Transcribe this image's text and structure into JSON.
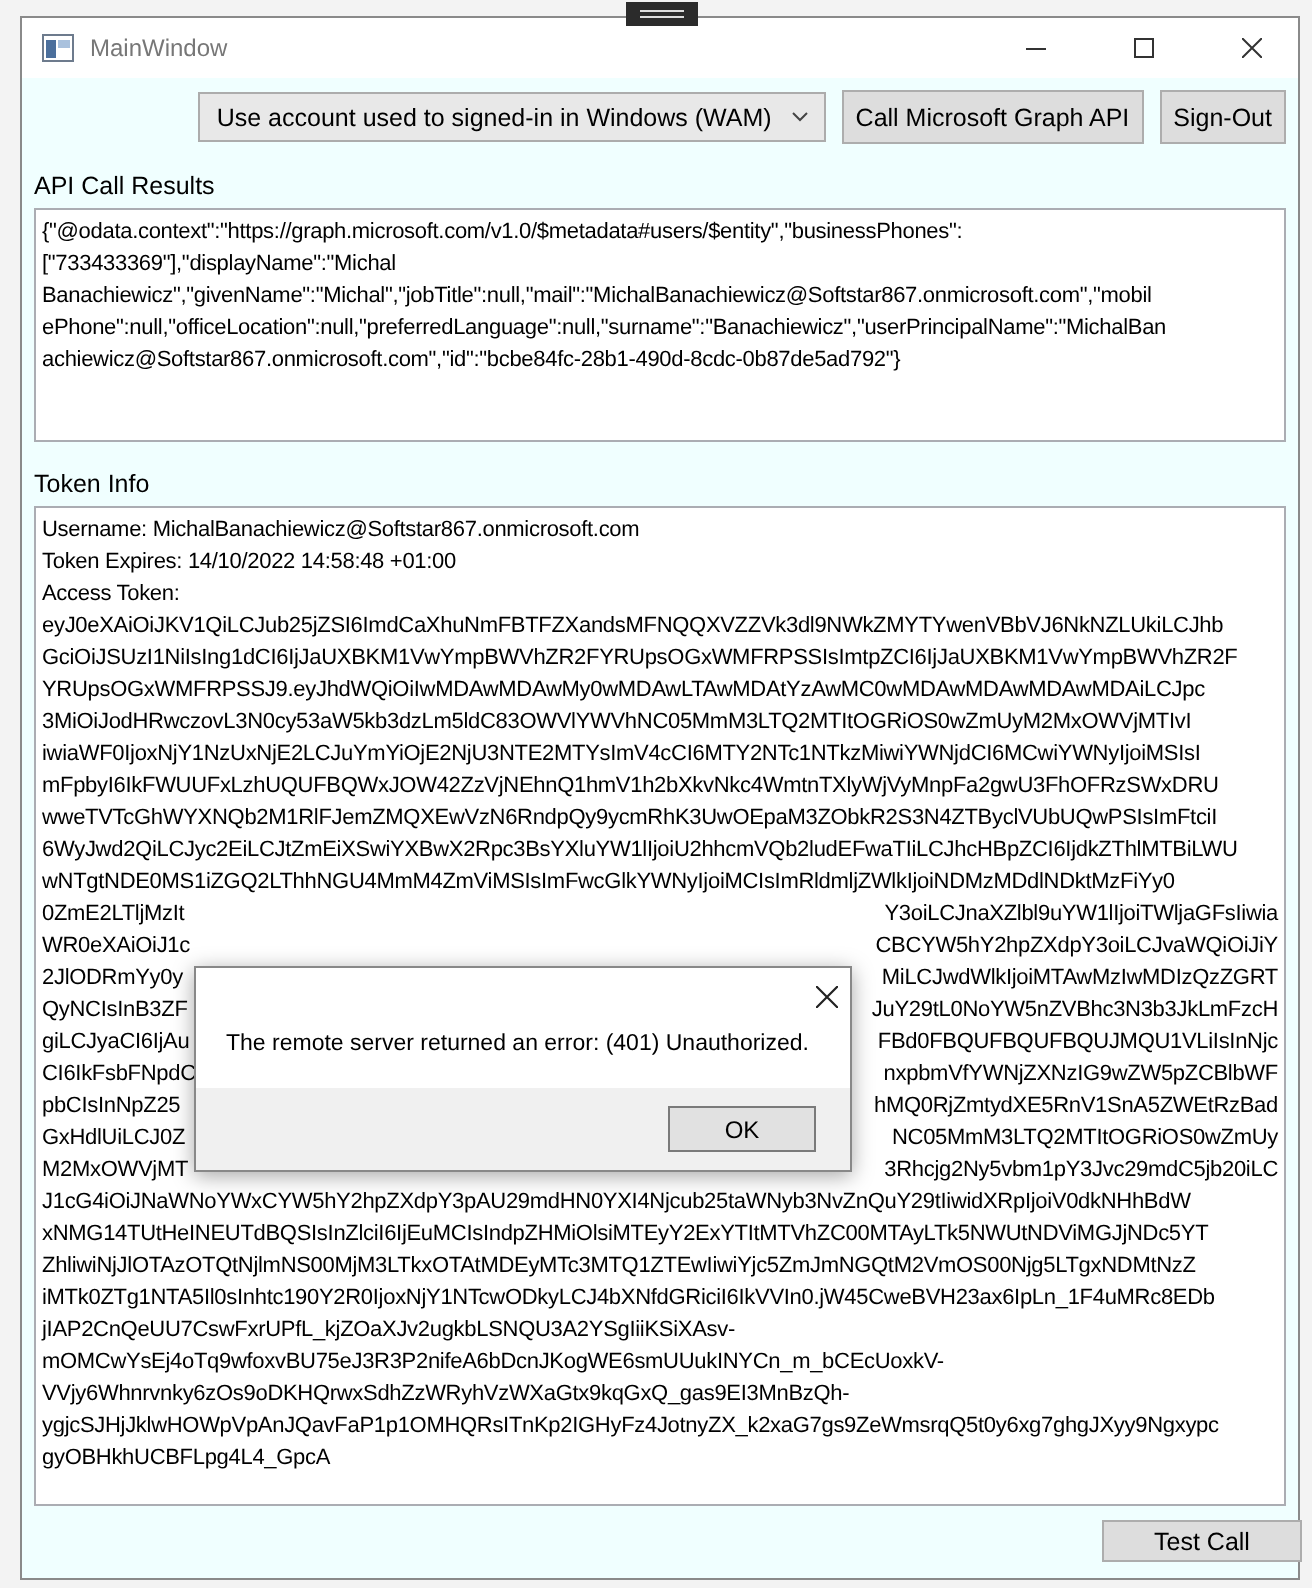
{
  "window": {
    "title": "MainWindow"
  },
  "toolbar": {
    "account_select": "Use account used to signed-in in Windows (WAM)",
    "buttons": [
      "Call Microsoft Graph API",
      "Sign-Out"
    ]
  },
  "api_results": {
    "label": "API Call Results",
    "lines": [
      "{\"@odata.context\":\"https://graph.microsoft.com/v1.0/$metadata#users/$entity\",\"businessPhones\":",
      "[\"733433369\"],\"displayName\":\"Michal",
      "Banachiewicz\",\"givenName\":\"Michal\",\"jobTitle\":null,\"mail\":\"MichalBanachiewicz@Softstar867.onmicrosoft.com\",\"mobil",
      "ePhone\":null,\"officeLocation\":null,\"preferredLanguage\":null,\"surname\":\"Banachiewicz\",\"userPrincipalName\":\"MichalBan",
      "achiewicz@Softstar867.onmicrosoft.com\",\"id\":\"bcbe84fc-28b1-490d-8cdc-0b87de5ad792\"}"
    ]
  },
  "token_info": {
    "label": "Token Info",
    "lines": [
      {
        "kind": "whole",
        "text": "Username: MichalBanachiewicz@Softstar867.onmicrosoft.com"
      },
      {
        "kind": "whole",
        "text": "Token Expires: 14/10/2022 14:58:48 +01:00"
      },
      {
        "kind": "whole",
        "text": "Access Token:"
      },
      {
        "kind": "whole",
        "text": "eyJ0eXAiOiJKV1QiLCJub25jZSI6ImdCaXhuNmFBTFZXandsMFNQQXVZZVk3dl9NWkZMYTYwenVBbVJ6NkNZLUkiLCJhb"
      },
      {
        "kind": "whole",
        "text": "GciOiJSUzI1NiIsIng1dCI6IjJaUXBKM1VwYmpBWVhZR2FYRUpsOGxWMFRPSSIsImtpZCI6IjJaUXBKM1VwYmpBWVhZR2F"
      },
      {
        "kind": "whole",
        "text": "YRUpsOGxWMFRPSSJ9.eyJhdWQiOiIwMDAwMDAwMy0wMDAwLTAwMDAtYzAwMC0wMDAwMDAwMDAwMDAiLCJpc"
      },
      {
        "kind": "whole",
        "text": "3MiOiJodHRwczovL3N0cy53aW5kb3dzLm5ldC83OWVlYWVhNC05MmM3LTQ2MTItOGRiOS0wZmUyM2MxOWVjMTIvI"
      },
      {
        "kind": "whole",
        "text": "iwiaWF0IjoxNjY1NzUxNjE2LCJuYmYiOjE2NjU3NTE2MTYsImV4cCI6MTY2NTc1NTkzMiwiYWNjdCI6MCwiYWNyIjoiMSIsI"
      },
      {
        "kind": "whole",
        "text": "mFpbyI6IkFWUUFxLzhUQUFBQWxJOW42ZzVjNEhnQ1hmV1h2bXkvNkc4WmtnTXlyWjVyMnpFa2gwU3FhOFRzSWxDRU"
      },
      {
        "kind": "whole",
        "text": "wweTVTcGhWYXNQb2M1RlFJemZMQXEwVzN6RndpQy9ycmRhK3UwOEpaM3ZObkR2S3N4ZTByclVUbUQwPSIsImFtciI"
      },
      {
        "kind": "whole",
        "text": "6WyJwd2QiLCJyc2EiLCJtZmEiXSwiYXBwX2Rpc3BsYXluYW1lIjoiU2hhcmVQb2ludEFwaTIiLCJhcHBpZCI6IjdkZThlMTBiLWU"
      },
      {
        "kind": "whole",
        "text": "wNTgtNDE0MS1iZGQ2LThhNGU4MmM4ZmViMSIsImFwcGlkYWNyIjoiMCIsImRldmljZWlkIjoiNDMzMDdlNDktMzFiYy0"
      },
      {
        "kind": "split",
        "left": "0ZmE2LTljMzIt",
        "right": "Y3oiLCJnaXZlbl9uYW1lIjoiTWljaGFsIiwia"
      },
      {
        "kind": "split",
        "left": "WR0eXAiOiJ1c",
        "right": "CBCYW5hY2hpZXdpY3oiLCJvaWQiOiJiY"
      },
      {
        "kind": "split",
        "left": "2JlODRmYy0y",
        "right": "MiLCJwdWlkIjoiMTAwMzIwMDIzQzZGRT"
      },
      {
        "kind": "split",
        "left": "QyNCIsInB3ZF",
        "right": "JuY29tL0NoYW5nZVBhc3N3b3JkLmFzcH"
      },
      {
        "kind": "split",
        "left": "giLCJyaCI6IjAu",
        "right": "FBd0FBQUFBQUFBQUJMQU1VLiIsInNjc"
      },
      {
        "kind": "split",
        "left": "CI6IkFsbFNpdC",
        "right": "nxpbmVfYWNjZXNzIG9wZW5pZCBlbWF"
      },
      {
        "kind": "split",
        "left": "pbCIsInNpZ25",
        "right": "hMQ0RjZmtydXE5RnV1SnA5ZWEtRzBad"
      },
      {
        "kind": "split",
        "left": "GxHdlUiLCJ0Z",
        "right": "NC05MmM3LTQ2MTItOGRiOS0wZmUy"
      },
      {
        "kind": "split",
        "left": "M2MxOWVjMT",
        "right": "3Rhcjg2Ny5vbm1pY3Jvc29mdC5jb20iLC"
      },
      {
        "kind": "whole",
        "text": "J1cG4iOiJNaWNoYWxCYW5hY2hpZXdpY3pAU29mdHN0YXI4Njcub25taWNyb3NvZnQuY29tIiwidXRpIjoiV0dkNHhBdW"
      },
      {
        "kind": "whole",
        "text": "xNMG14TUtHeINEUTdBQSIsInZlciI6IjEuMCIsIndpZHMiOlsiMTEyY2ExYTItMTVhZC00MTAyLTk5NWUtNDViMGJjNDc5YT"
      },
      {
        "kind": "whole",
        "text": "ZhliwiNjJlOTAzOTQtNjlmNS00MjM3LTkxOTAtMDEyMTc3MTQ1ZTEwIiwiYjc5ZmJmNGQtM2VmOS00Njg5LTgxNDMtNzZ"
      },
      {
        "kind": "whole",
        "text": "iMTk0ZTg1NTA5Il0sInhtc190Y2R0IjoxNjY1NTcwODkyLCJ4bXNfdGRiciI6IkVVIn0.jW45CweBVH23ax6IpLn_1F4uMRc8EDb"
      },
      {
        "kind": "whole",
        "text": "jIAP2CnQeUU7CswFxrUPfL_kjZOaXJv2ugkbLSNQU3A2YSgIiiKSiXAsv-"
      },
      {
        "kind": "whole",
        "text": "mOMCwYsEj4oTq9wfoxvBU75eJ3R3P2nifeA6bDcnJKogWE6smUUukINYCn_m_bCEcUoxkV-"
      },
      {
        "kind": "whole",
        "text": "VVjy6Whnrvnky6zOs9oDKHQrwxSdhZzWRyhVzWXaGtx9kqGxQ_gas9EI3MnBzQh-"
      },
      {
        "kind": "whole",
        "text": "ygjcSJHjJklwHOWpVpAnJQavFaP1p1OMHQRsITnKp2IGHyFz4JotnyZX_k2xaG7gs9ZeWmsrqQ5t0y6xg7ghgJXyy9Ngxypc"
      },
      {
        "kind": "whole",
        "text": "gyOBHkhUCBFLpg4L4_GpcA"
      }
    ]
  },
  "test_button": "Test Call",
  "dialog": {
    "message": "The remote server returned an error: (401) Unauthorized.",
    "button": "OK"
  }
}
